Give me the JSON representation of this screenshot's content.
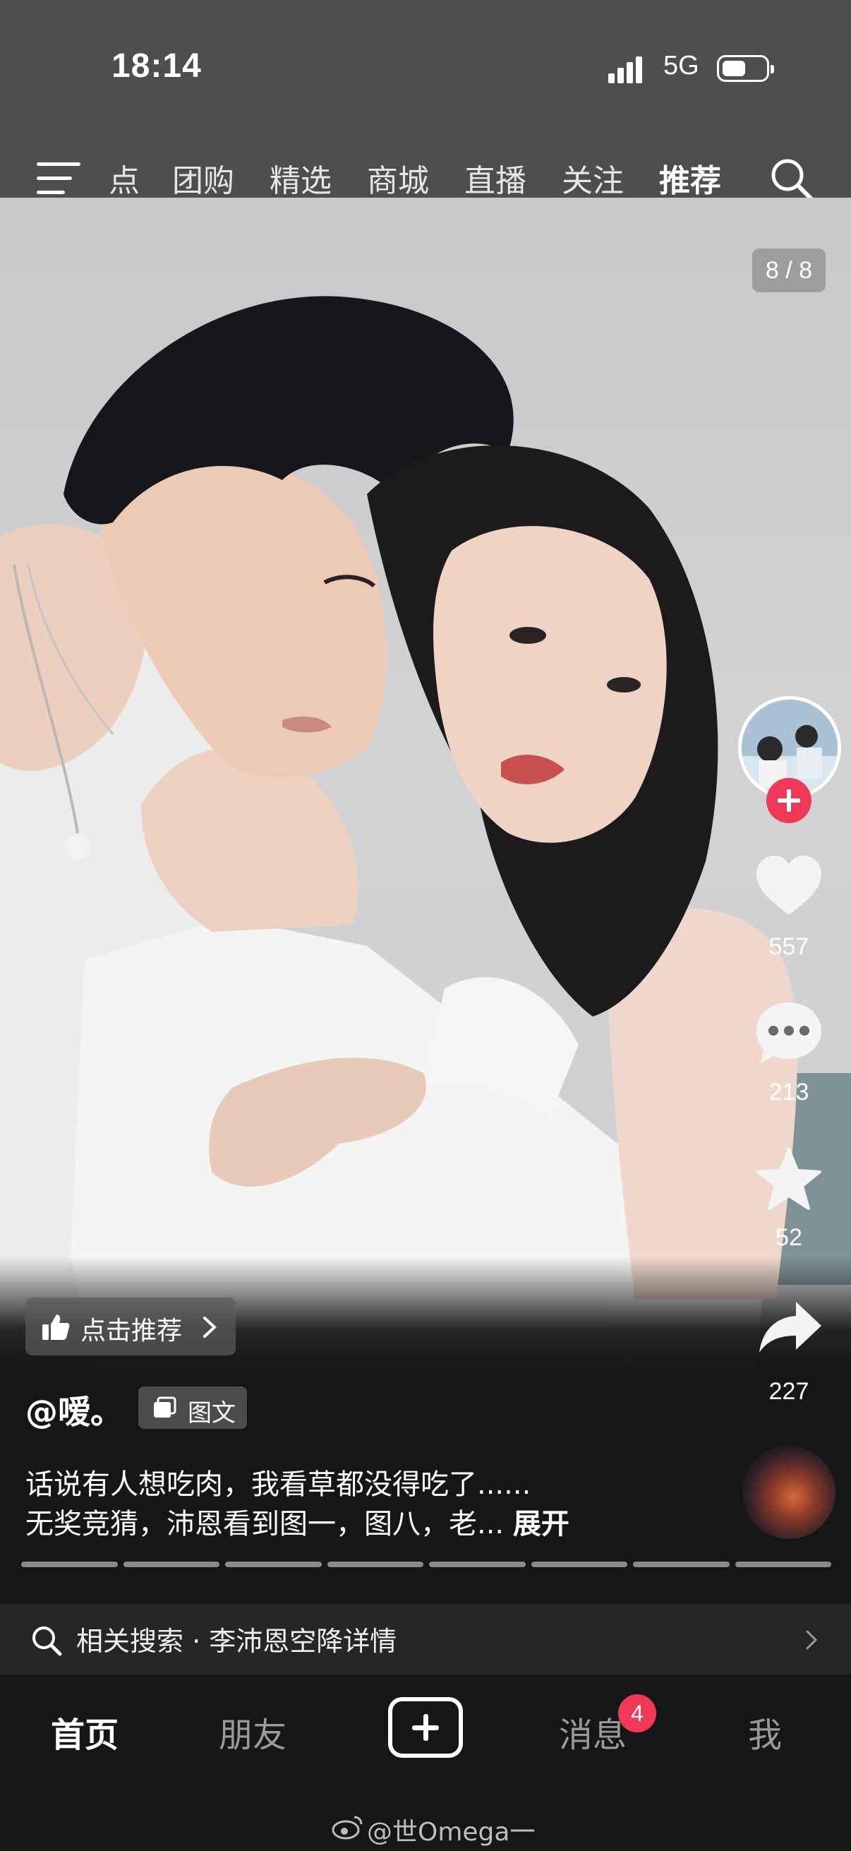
{
  "status": {
    "time": "18:14",
    "network": "5G"
  },
  "top_tabs": [
    {
      "label": "点"
    },
    {
      "label": "团购"
    },
    {
      "label": "精选"
    },
    {
      "label": "商城"
    },
    {
      "label": "直播"
    },
    {
      "label": "关注"
    },
    {
      "label": "推荐",
      "active": true
    }
  ],
  "post": {
    "page_indicator": "8 / 8",
    "likes": "557",
    "comments": "213",
    "favorites": "52",
    "shares": "227",
    "recommend_label": "点击推荐",
    "username": "@嗳。",
    "type_tag": "图文",
    "caption_line1": "话说有人想吃肉，我看草都没得吃了......",
    "caption_line2": "无奖竞猜，沛恩看到图一，图八，老...",
    "expand_label": "展开",
    "image_count": 8,
    "current_image": 8
  },
  "related_search": {
    "text": "相关搜索 · 李沛恩空降详情"
  },
  "bottom_nav": {
    "home": "首页",
    "friends": "朋友",
    "messages": "消息",
    "messages_badge": "4",
    "me": "我"
  },
  "watermark": "@世Omega一",
  "colors": {
    "accent": "#f03858",
    "status_bar_bg": "#4e4e4e",
    "nav_bg": "#161616"
  }
}
